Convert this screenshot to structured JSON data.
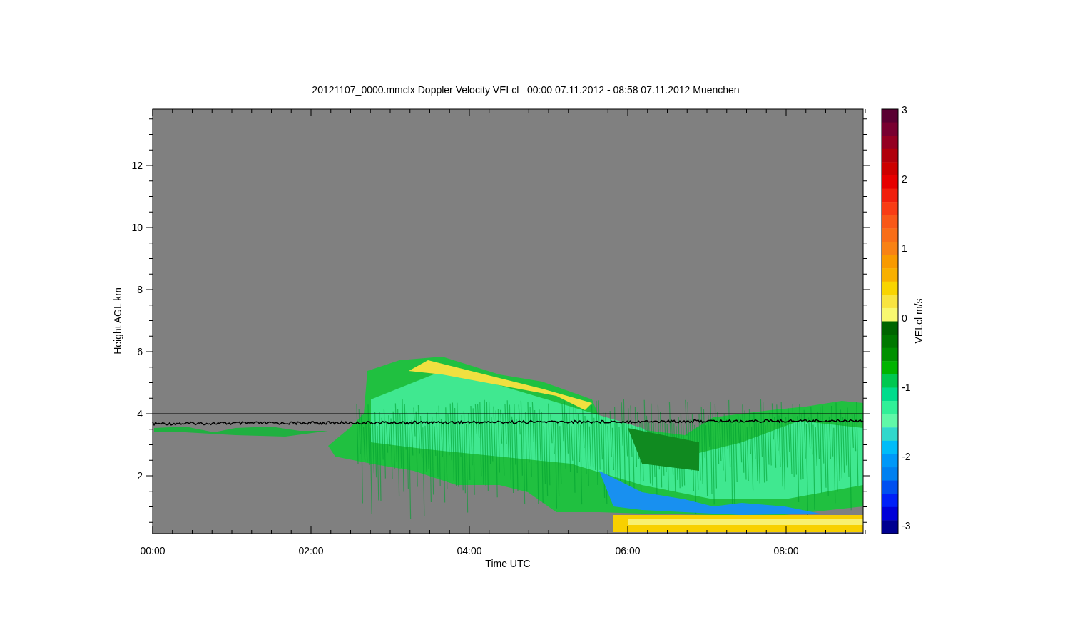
{
  "title": "20121107_0000.mmclx Doppler Velocity VELcl   00:00 07.11.2012 - 08:58 07.11.2012 Muenchen",
  "x_axis": {
    "label": "Time UTC",
    "ticks": [
      "00:00",
      "02:00",
      "04:00",
      "06:00",
      "08:00"
    ]
  },
  "y_axis": {
    "label": "Height AGL km",
    "ticks": [
      "12",
      "10",
      "8",
      "6",
      "4",
      "2"
    ]
  },
  "colorbar": {
    "label": "VELcl m/s",
    "ticks": [
      "3",
      "2",
      "1",
      "0",
      "-1",
      "-2",
      "-3"
    ],
    "segments": [
      {
        "color": "#5a0032"
      },
      {
        "color": "#780030"
      },
      {
        "color": "#940022"
      },
      {
        "color": "#b0000c"
      },
      {
        "color": "#cc0000"
      },
      {
        "color": "#e60000"
      },
      {
        "color": "#f01e0c"
      },
      {
        "color": "#f83c14"
      },
      {
        "color": "#f85818"
      },
      {
        "color": "#f86e18"
      },
      {
        "color": "#f88214"
      },
      {
        "color": "#f89a00"
      },
      {
        "color": "#f8b000"
      },
      {
        "color": "#f8d400"
      },
      {
        "color": "#f8e440"
      },
      {
        "color": "#f8f870"
      },
      {
        "color": "#006400"
      },
      {
        "color": "#007800"
      },
      {
        "color": "#009000"
      },
      {
        "color": "#00b400"
      },
      {
        "color": "#00c850"
      },
      {
        "color": "#00dc8c"
      },
      {
        "color": "#30f098"
      },
      {
        "color": "#60f8a8"
      },
      {
        "color": "#30d8cc"
      },
      {
        "color": "#00bcf8"
      },
      {
        "color": "#0098f8"
      },
      {
        "color": "#0080f0"
      },
      {
        "color": "#0050f0"
      },
      {
        "color": "#0020f8"
      },
      {
        "color": "#0000d8"
      },
      {
        "color": "#000090"
      }
    ]
  }
}
